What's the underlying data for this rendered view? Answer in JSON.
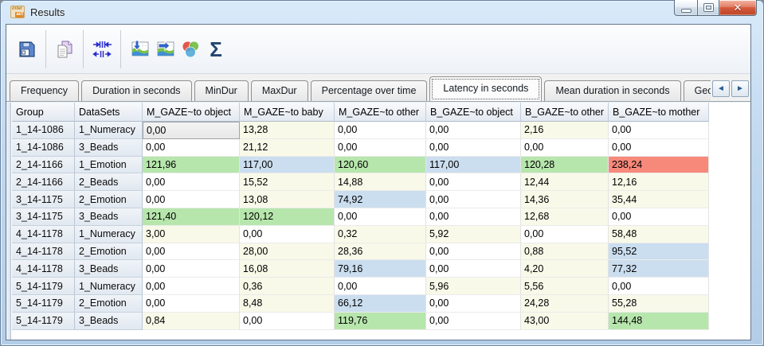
{
  "window": {
    "title": "Results",
    "logo_top": "inter",
    "logo_bottom": "act",
    "controls": [
      "minimize",
      "maximize",
      "close"
    ]
  },
  "toolbar": {
    "items": [
      {
        "name": "save",
        "icon": "save-icon"
      },
      {
        "name": "copy",
        "icon": "copy-icon"
      },
      {
        "name": "fit-column-width",
        "icon": "column-width-icon"
      },
      {
        "name": "chart-import",
        "icon": "chart-arrow-down-icon"
      },
      {
        "name": "chart-export",
        "icon": "chart-arrow-right-icon"
      },
      {
        "name": "compare",
        "icon": "venn-circles-icon"
      },
      {
        "name": "sum",
        "icon": "sigma-icon",
        "glyph": "Σ"
      }
    ]
  },
  "tabs": {
    "selected_index": 5,
    "scroll_left": "◄",
    "scroll_right": "►",
    "items": [
      "Frequency",
      "Duration in seconds",
      "MinDur",
      "MaxDur",
      "Percentage over time",
      "Latency in seconds",
      "Mean duration in seconds",
      "Geometric mean dura"
    ]
  },
  "table": {
    "columns": [
      "Group",
      "DataSets",
      "M_GAZE~to object",
      "M_GAZE~to baby",
      "M_GAZE~to other",
      "B_GAZE~to object",
      "B_GAZE~to other",
      "B_GAZE~to mother"
    ],
    "cell_colors": {
      "zero": "#ffffff",
      "low": "#f8f9e8",
      "mid": "#cbdeef",
      "high": "#b7e6ad",
      "max": "#f7897b"
    },
    "rows": [
      {
        "group": "1_14-1086",
        "dataset": "1_Numeracy",
        "cells": [
          {
            "v": "0,00",
            "c": "zero",
            "selected": true
          },
          {
            "v": "13,28",
            "c": "low"
          },
          {
            "v": "0,00",
            "c": "zero"
          },
          {
            "v": "0,00",
            "c": "zero"
          },
          {
            "v": "2,16",
            "c": "low"
          },
          {
            "v": "0,00",
            "c": "zero"
          }
        ]
      },
      {
        "group": "1_14-1086",
        "dataset": "3_Beads",
        "cells": [
          {
            "v": "0,00",
            "c": "zero"
          },
          {
            "v": "21,12",
            "c": "low"
          },
          {
            "v": "0,00",
            "c": "zero"
          },
          {
            "v": "0,00",
            "c": "zero"
          },
          {
            "v": "0,00",
            "c": "zero"
          },
          {
            "v": "0,00",
            "c": "zero"
          }
        ]
      },
      {
        "group": "2_14-1166",
        "dataset": "1_Emotion",
        "cells": [
          {
            "v": "121,96",
            "c": "high"
          },
          {
            "v": "117,00",
            "c": "mid"
          },
          {
            "v": "120,60",
            "c": "high"
          },
          {
            "v": "117,00",
            "c": "mid"
          },
          {
            "v": "120,28",
            "c": "high"
          },
          {
            "v": "238,24",
            "c": "max"
          }
        ]
      },
      {
        "group": "2_14-1166",
        "dataset": "2_Beads",
        "cells": [
          {
            "v": "0,00",
            "c": "zero"
          },
          {
            "v": "15,52",
            "c": "low"
          },
          {
            "v": "14,88",
            "c": "low"
          },
          {
            "v": "0,00",
            "c": "zero"
          },
          {
            "v": "12,44",
            "c": "low"
          },
          {
            "v": "12,16",
            "c": "low"
          }
        ]
      },
      {
        "group": "3_14-1175",
        "dataset": "2_Emotion",
        "cells": [
          {
            "v": "0,00",
            "c": "zero"
          },
          {
            "v": "13,08",
            "c": "low"
          },
          {
            "v": "74,92",
            "c": "mid"
          },
          {
            "v": "0,00",
            "c": "zero"
          },
          {
            "v": "14,36",
            "c": "low"
          },
          {
            "v": "35,44",
            "c": "low"
          }
        ]
      },
      {
        "group": "3_14-1175",
        "dataset": "3_Beads",
        "cells": [
          {
            "v": "121,40",
            "c": "high"
          },
          {
            "v": "120,12",
            "c": "high"
          },
          {
            "v": "0,00",
            "c": "zero"
          },
          {
            "v": "0,00",
            "c": "zero"
          },
          {
            "v": "12,68",
            "c": "low"
          },
          {
            "v": "0,00",
            "c": "zero"
          }
        ]
      },
      {
        "group": "4_14-1178",
        "dataset": "1_Numeracy",
        "cells": [
          {
            "v": "3,00",
            "c": "low"
          },
          {
            "v": "0,00",
            "c": "zero"
          },
          {
            "v": "0,32",
            "c": "low"
          },
          {
            "v": "5,92",
            "c": "low"
          },
          {
            "v": "0,00",
            "c": "zero"
          },
          {
            "v": "58,48",
            "c": "low"
          }
        ]
      },
      {
        "group": "4_14-1178",
        "dataset": "2_Emotion",
        "cells": [
          {
            "v": "0,00",
            "c": "zero"
          },
          {
            "v": "28,00",
            "c": "low"
          },
          {
            "v": "28,36",
            "c": "low"
          },
          {
            "v": "0,00",
            "c": "zero"
          },
          {
            "v": "0,88",
            "c": "low"
          },
          {
            "v": "95,52",
            "c": "mid"
          }
        ]
      },
      {
        "group": "4_14-1178",
        "dataset": "3_Beads",
        "cells": [
          {
            "v": "0,00",
            "c": "zero"
          },
          {
            "v": "16,08",
            "c": "low"
          },
          {
            "v": "79,16",
            "c": "mid"
          },
          {
            "v": "0,00",
            "c": "zero"
          },
          {
            "v": "4,20",
            "c": "low"
          },
          {
            "v": "77,32",
            "c": "mid"
          }
        ]
      },
      {
        "group": "5_14-1179",
        "dataset": "1_Numeracy",
        "cells": [
          {
            "v": "0,00",
            "c": "zero"
          },
          {
            "v": "0,36",
            "c": "low"
          },
          {
            "v": "0,00",
            "c": "zero"
          },
          {
            "v": "5,96",
            "c": "low"
          },
          {
            "v": "5,56",
            "c": "low"
          },
          {
            "v": "0,00",
            "c": "zero"
          }
        ]
      },
      {
        "group": "5_14-1179",
        "dataset": "2_Emotion",
        "cells": [
          {
            "v": "0,00",
            "c": "zero"
          },
          {
            "v": "8,48",
            "c": "low"
          },
          {
            "v": "66,12",
            "c": "mid"
          },
          {
            "v": "0,00",
            "c": "zero"
          },
          {
            "v": "24,28",
            "c": "low"
          },
          {
            "v": "55,28",
            "c": "low"
          }
        ]
      },
      {
        "group": "5_14-1179",
        "dataset": "3_Beads",
        "cells": [
          {
            "v": "0,84",
            "c": "low"
          },
          {
            "v": "0,00",
            "c": "zero"
          },
          {
            "v": "119,76",
            "c": "high"
          },
          {
            "v": "0,00",
            "c": "zero"
          },
          {
            "v": "43,00",
            "c": "low"
          },
          {
            "v": "144,48",
            "c": "high"
          }
        ]
      }
    ]
  }
}
